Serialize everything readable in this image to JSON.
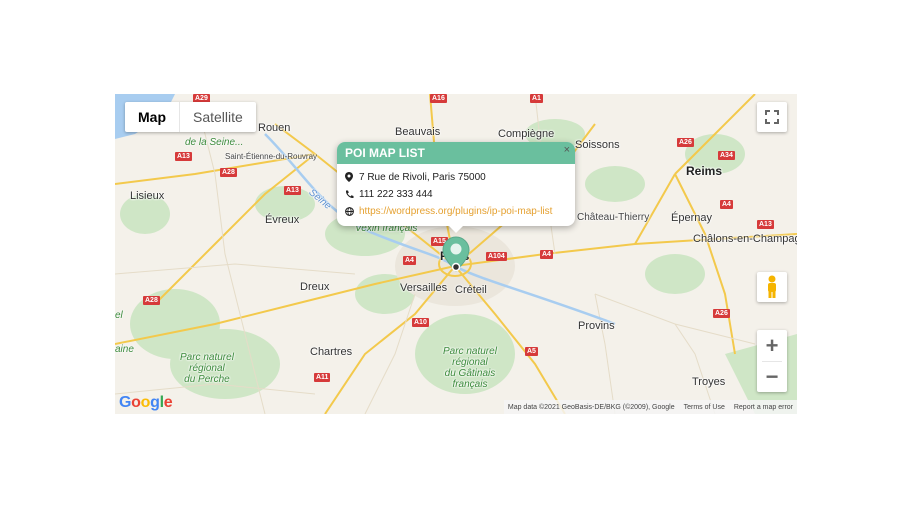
{
  "map_type": {
    "map_label": "Map",
    "satellite_label": "Satellite",
    "selected": "Map"
  },
  "popup": {
    "title": "POI MAP LIST",
    "close": "×",
    "address": "7 Rue de Rivoli, Paris 75000",
    "phone": "111 222 333 444",
    "url": "https://wordpress.org/plugins/ip-poi-map-list"
  },
  "cities": {
    "rouen": "Rouen",
    "beauvais": "Beauvais",
    "compiegne": "Compiègne",
    "soissons": "Soissons",
    "reims": "Reims",
    "lisieux": "Lisieux",
    "evreux": "Évreux",
    "chateau_thierry": "Château-Thierry",
    "epernay": "Épernay",
    "chalons": "Châlons-en-Champagne",
    "paris": "Paris",
    "versailles": "Versailles",
    "creteil": "Créteil",
    "dreux": "Dreux",
    "provins": "Provins",
    "chartres": "Chartres",
    "troyes": "Troyes",
    "st_etienne": "Saint-Étienne-du-Rouvray",
    "vexin": "Vexin français"
  },
  "parks": {
    "seine": "de la Seine...",
    "perche": "Parc naturel\nrégional\ndu Perche",
    "gatinais": "Parc naturel\nrégional\ndu Gâtinais\nfrançais",
    "left_edge_1": "el",
    "left_edge_2": "aine"
  },
  "river": "Seine",
  "roads": [
    "A29",
    "A13",
    "A28",
    "A13",
    "A16",
    "A1",
    "A26",
    "A34",
    "A4",
    "A4",
    "A15",
    "A104",
    "A4",
    "A28",
    "A10",
    "A5",
    "A11",
    "A26",
    "A13"
  ],
  "controls": {
    "zoom_in": "+",
    "zoom_out": "−"
  },
  "attribution": {
    "map_data": "Map data ©2021 GeoBasis-DE/BKG (©2009), Google",
    "terms": "Terms of Use",
    "report": "Report a map error"
  },
  "logo": "Google",
  "colors": {
    "popup_header": "#6abf9e",
    "link": "#e5a131",
    "marker": "#6abf9e",
    "road_shield": "#d63a3a"
  }
}
